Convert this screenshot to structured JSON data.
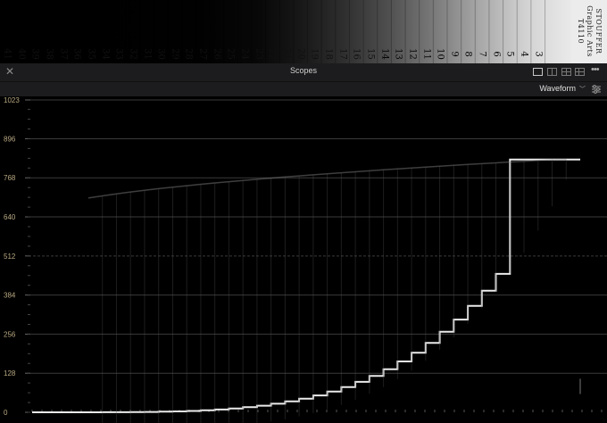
{
  "wedge": {
    "step_numbers": [
      "41",
      "40",
      "39",
      "38",
      "37",
      "36",
      "35",
      "34",
      "33",
      "32",
      "31",
      "30",
      "29",
      "28",
      "27",
      "26",
      "25",
      "24",
      "23",
      "22",
      "21",
      "20",
      "19",
      "18",
      "17",
      "16",
      "15",
      "14",
      "13",
      "12",
      "11",
      "10",
      "9",
      "8",
      "7",
      "6",
      "5",
      "4",
      "3"
    ],
    "label_brand": "STOUFFER",
    "label_line2": "Graphic Arts",
    "label_line3": "T4110"
  },
  "header": {
    "title": "Scopes",
    "close_icon": "close-icon",
    "more_icon": "more-horizontal-icon"
  },
  "toolbar": {
    "scope_type": "Waveform",
    "chevron_icon": "chevron-down-icon",
    "settings_icon": "settings-sliders-icon"
  },
  "scope": {
    "y_ticks": [
      "1023",
      "896",
      "768",
      "640",
      "512",
      "384",
      "256",
      "128",
      "0"
    ],
    "tick_color": "#b8a882",
    "trace_color": "#ffffff"
  }
}
